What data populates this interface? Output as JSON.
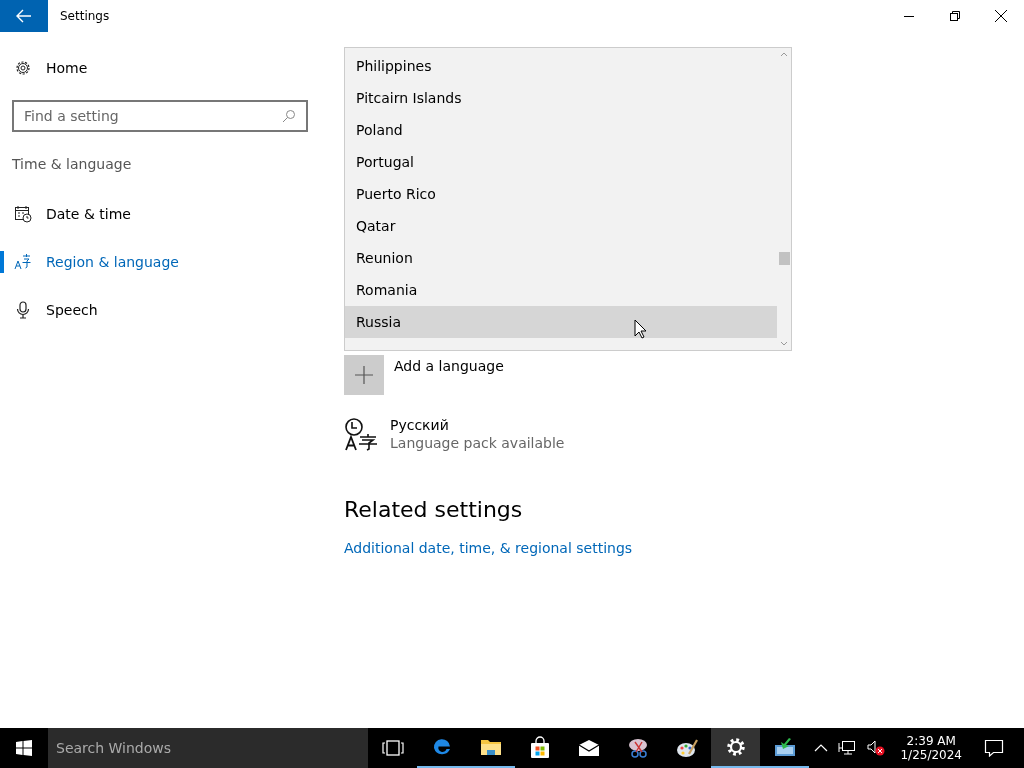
{
  "window": {
    "title": "Settings"
  },
  "sidebar": {
    "home": "Home",
    "search": {
      "placeholder": "Find a setting"
    },
    "section": "Time & language",
    "items": [
      {
        "label": "Date & time",
        "kind": "calendar",
        "selected": false
      },
      {
        "label": "Region & language",
        "kind": "language",
        "selected": true
      },
      {
        "label": "Speech",
        "kind": "microphone",
        "selected": false
      }
    ]
  },
  "region_list": {
    "items": [
      {
        "label": "Philippines",
        "selected": false
      },
      {
        "label": "Pitcairn Islands",
        "selected": false
      },
      {
        "label": "Poland",
        "selected": false
      },
      {
        "label": "Portugal",
        "selected": false
      },
      {
        "label": "Puerto Rico",
        "selected": false
      },
      {
        "label": "Qatar",
        "selected": false
      },
      {
        "label": "Reunion",
        "selected": false
      },
      {
        "label": "Romania",
        "selected": false
      },
      {
        "label": "Russia",
        "selected": true
      }
    ]
  },
  "add_language": {
    "label": "Add a language"
  },
  "languages": [
    {
      "name": "Русский",
      "status": "Language pack available"
    }
  ],
  "related": {
    "heading": "Related settings",
    "links": [
      "Additional date, time, & regional settings"
    ]
  },
  "taskbar": {
    "search": {
      "placeholder": "Search Windows"
    },
    "apps": [
      {
        "kind": "task-view",
        "running": false,
        "selected": false
      },
      {
        "kind": "edge",
        "running": true,
        "selected": false
      },
      {
        "kind": "explorer",
        "running": true,
        "selected": false
      },
      {
        "kind": "store",
        "running": false,
        "selected": false
      },
      {
        "kind": "mail",
        "running": false,
        "selected": false
      },
      {
        "kind": "snip",
        "running": false,
        "selected": false
      },
      {
        "kind": "paint",
        "running": false,
        "selected": false
      },
      {
        "kind": "settings",
        "running": true,
        "selected": true
      },
      {
        "kind": "installer",
        "running": true,
        "selected": false
      }
    ],
    "tray": {
      "volume_muted": true,
      "time": "2:39 AM",
      "date": "1/25/2024"
    }
  }
}
